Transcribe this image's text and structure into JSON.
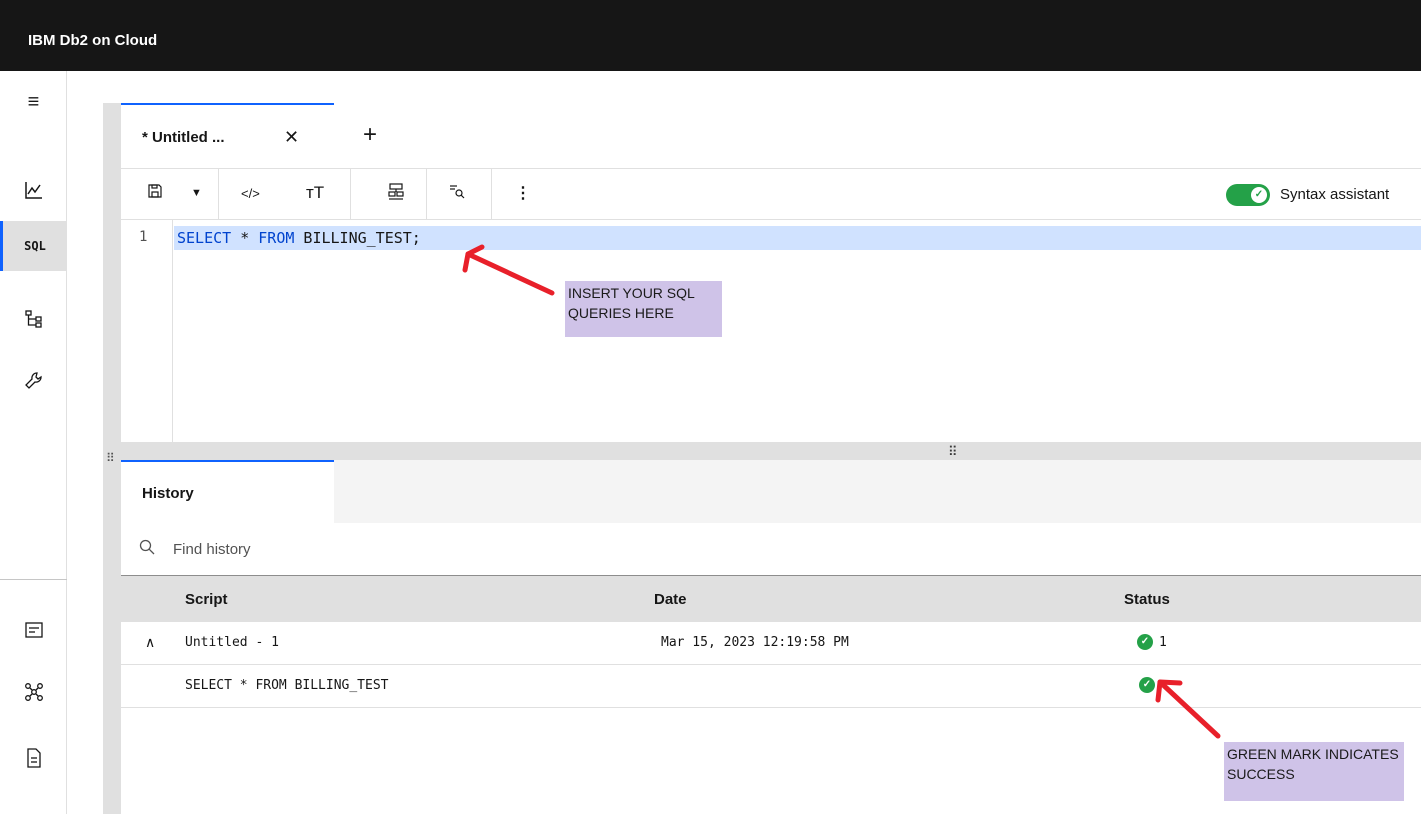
{
  "app": {
    "title": "IBM Db2 on Cloud"
  },
  "nav": {
    "sql_label": "SQL"
  },
  "editor_tabs": [
    {
      "label": "* Untitled ..."
    }
  ],
  "toolbar": {
    "syntax_assistant_label": "Syntax assistant",
    "syntax_assistant_on": true
  },
  "editor": {
    "line_number": "1",
    "code": {
      "kw1": "SELECT",
      "star": " * ",
      "kw2": "FROM",
      "rest": " BILLING_TEST;"
    }
  },
  "annotations": {
    "editor_callout": "INSERT YOUR SQL QUERIES HERE",
    "status_callout": "GREEN MARK INDICATES SUCCESS",
    "arrow_color": "#e8202a",
    "callout_color": "#cfc3e8"
  },
  "history": {
    "tab_label": "History",
    "search_placeholder": "Find history",
    "columns": {
      "script": "Script",
      "date": "Date",
      "status": "Status"
    },
    "rows": [
      {
        "script": "Untitled - 1",
        "date": "Mar 15, 2023 12:19:58 PM",
        "status_count": "1",
        "expanded": true
      },
      {
        "script": "SELECT * FROM BILLING_TEST",
        "date": "",
        "status_count": ""
      }
    ]
  },
  "colors": {
    "topbar": "#161616",
    "accent": "#0f62fe",
    "success": "#24a148",
    "selection": "#d0e2ff"
  }
}
